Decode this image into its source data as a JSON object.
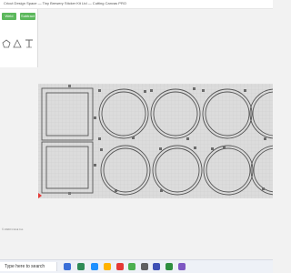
{
  "window": {
    "title": "Cricut Design Space — Tiny Brewery Sticker Kit Ltd — Cutting Canvas PRO"
  },
  "toolbar": {
    "weld_label": "Weld",
    "subtract_label": "Subtract"
  },
  "tools": [
    {
      "icon": "pentagon-icon"
    },
    {
      "icon": "triangle-icon"
    },
    {
      "icon": "text-tool-icon"
    }
  ],
  "status": {
    "left_text": "© 2023 Cricut Inc."
  },
  "taskbar": {
    "search_placeholder": "Type here to search"
  },
  "colors": {
    "accent": "#5cb85c",
    "mat_bg": "#d8d8d8",
    "shape_stroke": "#555555",
    "mat_origin": "#e53935"
  }
}
